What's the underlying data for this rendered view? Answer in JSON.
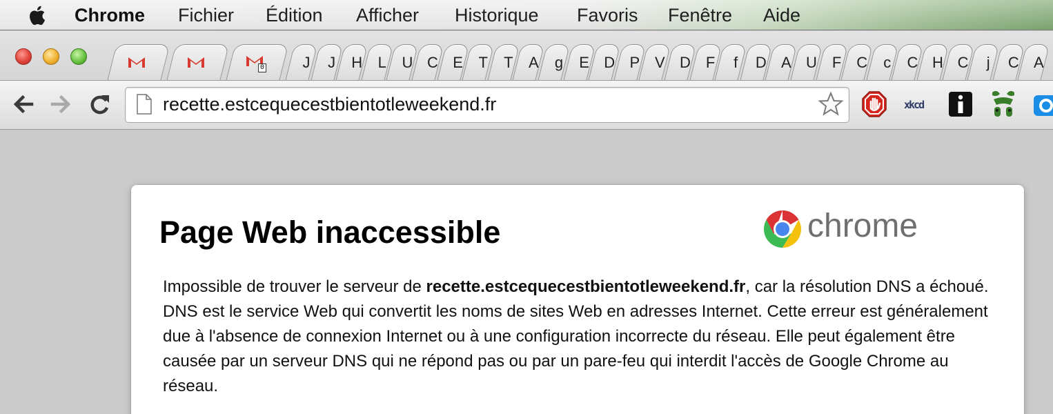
{
  "menubar": {
    "app_name": "Chrome",
    "items": [
      "Fichier",
      "Édition",
      "Afficher",
      "Historique",
      "Favoris",
      "Fenêtre",
      "Aide"
    ]
  },
  "tabs": {
    "gmail_badge": "0",
    "letters": [
      "J",
      "J",
      "H",
      "L",
      "U",
      "C",
      "E",
      "T",
      "T",
      "A",
      "g",
      "E",
      "D",
      "P",
      "V",
      "D",
      "F",
      "f",
      "D",
      "A",
      "U",
      "F",
      "C",
      "c",
      "C",
      "H",
      "C",
      "j",
      "C",
      "A"
    ]
  },
  "omnibox": {
    "url": "recette.estcequecestbientotleweekend.fr"
  },
  "extensions": [
    "adblock-icon",
    "xkcd-icon",
    "info-icon",
    "alien-icon",
    "extension-partial-icon"
  ],
  "error_page": {
    "title": "Page Web inaccessible",
    "brand": "chrome",
    "message_before": "Impossible de trouver le serveur de ",
    "host": "recette.estcequecestbientotleweekend.fr",
    "message_after": ", car la résolution DNS a échoué. DNS est le service Web qui convertit les noms de sites Web en adresses Internet. Cette erreur est généralement due à l'absence de connexion Internet ou à une configuration incorrecte du réseau. Elle peut également être causée par un serveur DNS qui ne répond pas ou par un pare-feu qui interdit l'accès de Google Chrome au réseau."
  },
  "colors": {
    "accent_red": "#e0443a",
    "content_bg": "#cbcbcb",
    "brand_grey": "#6f6f6f"
  }
}
